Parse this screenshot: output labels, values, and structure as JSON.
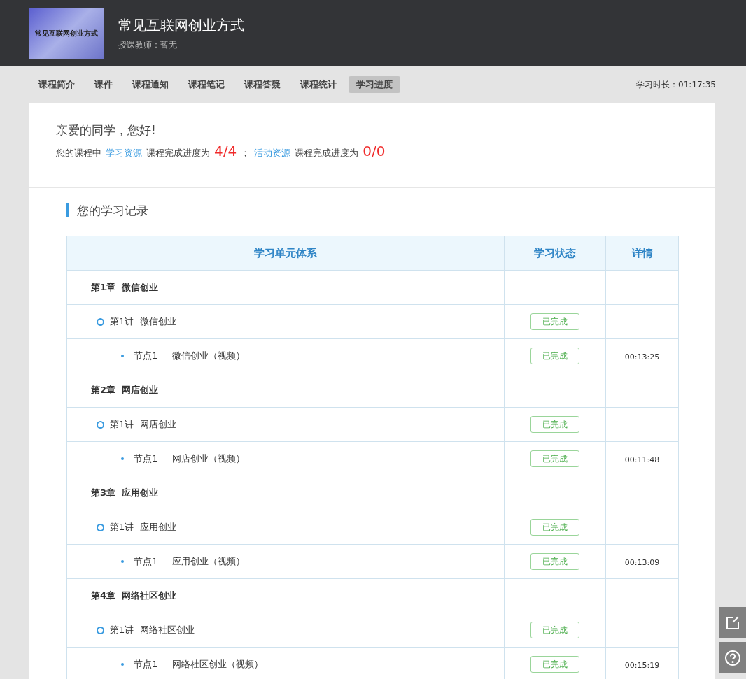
{
  "course": {
    "title": "常见互联网创业方式",
    "thumbnail_text": "常见互联网创业方式",
    "teacher": "授课教师：暂无"
  },
  "tabs": [
    {
      "label": "课程简介",
      "selected": false
    },
    {
      "label": "课件",
      "selected": false
    },
    {
      "label": "课程通知",
      "selected": false
    },
    {
      "label": "课程笔记",
      "selected": false
    },
    {
      "label": "课程答疑",
      "selected": false
    },
    {
      "label": "课程统计",
      "selected": false
    },
    {
      "label": "学习进度",
      "selected": true
    }
  ],
  "study_time": "学习时长：01:17:35",
  "greeting": "亲爱的同学，您好!",
  "progress": {
    "prefix": "您的课程中",
    "link_1": "学习资源",
    "mid_1": "课程完成进度为",
    "value_1": "4/4",
    "separator": "；",
    "link_2": "活动资源",
    "mid_2": "课程完成进度为",
    "value_2": "0/0"
  },
  "records": {
    "title": "您的学习记录",
    "columns": [
      "学习单元体系",
      "学习状态",
      "详情"
    ],
    "chapters": [
      {
        "number": "第1章",
        "name": "微信创业",
        "children": [
          {
            "number": "第1讲",
            "name": "微信创业",
            "status": "已完成",
            "children": [
              {
                "number": "节点1",
                "name": "微信创业（视频）",
                "status": "已完成",
                "duration": "00:13:25"
              }
            ]
          }
        ]
      },
      {
        "number": "第2章",
        "name": "网店创业",
        "children": [
          {
            "number": "第1讲",
            "name": "网店创业",
            "status": "已完成",
            "children": [
              {
                "number": "节点1",
                "name": "网店创业（视频）",
                "status": "已完成",
                "duration": "00:11:48"
              }
            ]
          }
        ]
      },
      {
        "number": "第3章",
        "name": "应用创业",
        "children": [
          {
            "number": "第1讲",
            "name": "应用创业",
            "status": "已完成",
            "children": [
              {
                "number": "节点1",
                "name": "应用创业（视频）",
                "status": "已完成",
                "duration": "00:13:09"
              }
            ]
          }
        ]
      },
      {
        "number": "第4章",
        "name": "网络社区创业",
        "children": [
          {
            "number": "第1讲",
            "name": "网络社区创业",
            "status": "已完成",
            "children": [
              {
                "number": "节点1",
                "name": "网络社区创业（视频）",
                "status": "已完成",
                "duration": "00:15:19"
              }
            ]
          }
        ]
      }
    ]
  }
}
